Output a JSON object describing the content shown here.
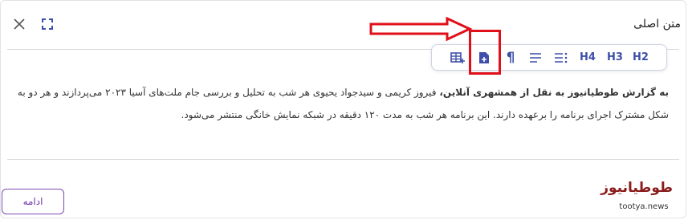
{
  "dialog": {
    "title": "متن اصلی",
    "icons": {
      "close": "close-icon",
      "expand": "expand-icon"
    }
  },
  "toolbar": {
    "items": [
      {
        "name": "insert-table-icon",
        "label": ""
      },
      {
        "name": "insert-document-icon",
        "label": ""
      },
      {
        "name": "paragraph-icon",
        "label": "¶"
      },
      {
        "name": "align-icon",
        "label": ""
      },
      {
        "name": "list-icon",
        "label": ""
      },
      {
        "name": "heading-4",
        "label": "H4"
      },
      {
        "name": "heading-3",
        "label": "H3"
      },
      {
        "name": "heading-2",
        "label": "H2"
      }
    ]
  },
  "content": {
    "bold_lead": "به گزارش طوطیانیوز به نقل از همشهری آنلاین،",
    "rest": " فیروز کریمی و سیدجواد یحیوی هر شب به تحلیل و بررسی جام ملت‌های آسیا ۲۰۲۳ می‌پردازند و هر دو به شکل مشترک اجرای برنامه را برعهده دارند. این برنامه هر شب به مدت ۱۲۰ دقیقه در شبکه نمایش خانگی منتشر می‌شود."
  },
  "footer": {
    "continue_label": "ادامه",
    "logo_text": "طوطیانیوز",
    "logo_url": "tootya.news"
  },
  "colors": {
    "accent": "#3d4fa8",
    "button_border": "#7b4bb3",
    "annotation": "#e0101a",
    "logo": "#8a1c1c"
  }
}
